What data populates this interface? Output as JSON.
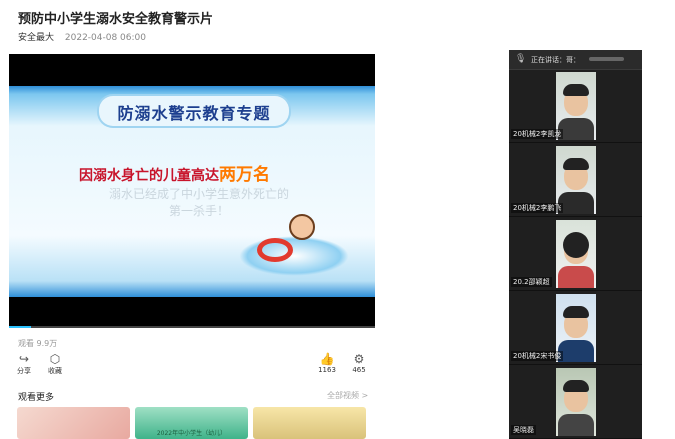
{
  "article": {
    "title": "预防中小学生溺水安全教育警示片",
    "author": "安全最大",
    "date": "2022-04-08 06:00"
  },
  "video": {
    "progress": 0.06,
    "slide": {
      "title": "防溺水警示教育专题",
      "headline_prefix": "因溺水身亡的儿童高达",
      "headline_highlight": "两万名",
      "faded_line1": "溺水已经成了中小学生意外死亡的",
      "faded_line2": "第一杀手！"
    }
  },
  "stats": {
    "views_label": "观看 9.9万"
  },
  "actions": {
    "share": "分享",
    "collect": "收藏",
    "like_count": "1163",
    "settings_count": "465"
  },
  "more": {
    "heading": "观看更多",
    "all_videos": "全部视频 >",
    "thumbs": [
      {
        "caption": ""
      },
      {
        "caption": "2022年中小学生（幼儿）"
      },
      {
        "caption": ""
      }
    ]
  },
  "call": {
    "speaking_label": "正在讲话：哥：",
    "participants": [
      {
        "name": "20机械2李凯龙"
      },
      {
        "name": "20机械2李鹏飞"
      },
      {
        "name": "20.2邵颖超"
      },
      {
        "name": "20机械2宋书俊"
      },
      {
        "name": "吴晓磊"
      }
    ]
  },
  "colors": {
    "accent_blue": "#2f8fd8",
    "headline_red": "#c8142b",
    "highlight_orange": "#ff7a00",
    "call_bg": "#1f1f1f"
  }
}
